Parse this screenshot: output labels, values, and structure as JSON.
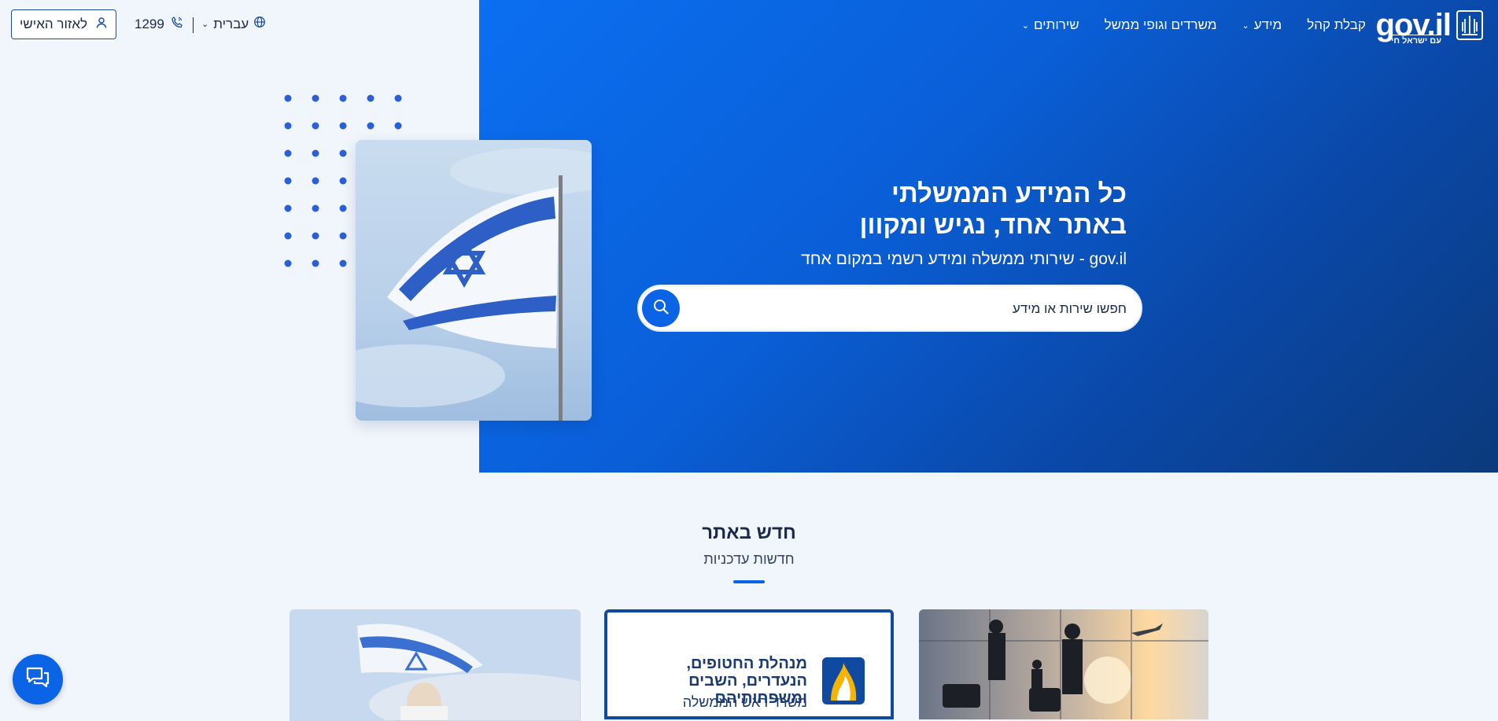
{
  "header": {
    "logo_text": "gov.il",
    "logo_tagline": "עם ישראל חי",
    "nav": [
      {
        "label": "שירותים",
        "has_dropdown": true
      },
      {
        "label": "משרדים וגופי ממשל",
        "has_dropdown": false
      },
      {
        "label": "מידע",
        "has_dropdown": true
      },
      {
        "label": "קבלת קהל",
        "has_dropdown": false
      }
    ],
    "personal_area_label": "לאזור האישי",
    "phone_number": "1299",
    "language_label": "עברית"
  },
  "hero": {
    "title_line1": "כל המידע הממשלתי",
    "title_line2": "באתר אחד, נגיש ומקוון",
    "subtitle": "gov.il - שירותי ממשלה ומידע רשמי במקום אחד",
    "search_placeholder": "חפשו שירות או מידע"
  },
  "section": {
    "title": "חדש באתר",
    "subtitle": "חדשות עדכניות"
  },
  "cards": [
    {
      "heading": "",
      "kind": "photo-flag"
    },
    {
      "heading": "מנהלת החטופים, הנעדרים, השבים ומשפחותיהם",
      "subheading": "משרד ראש הממשלה",
      "kind": "logo"
    },
    {
      "heading": "",
      "kind": "photo-airport"
    }
  ],
  "colors": {
    "primary": "#0b63e5",
    "hero_gradient_start": "#0b6ff0",
    "hero_gradient_end": "#0b3a7c",
    "page_bg": "#f0f6fc",
    "text_dark": "#1b2a4a"
  },
  "icons": [
    "gov-emblem-icon",
    "chevron-down-icon",
    "user-icon",
    "phone-icon",
    "globe-icon",
    "search-icon",
    "chat-icon"
  ]
}
